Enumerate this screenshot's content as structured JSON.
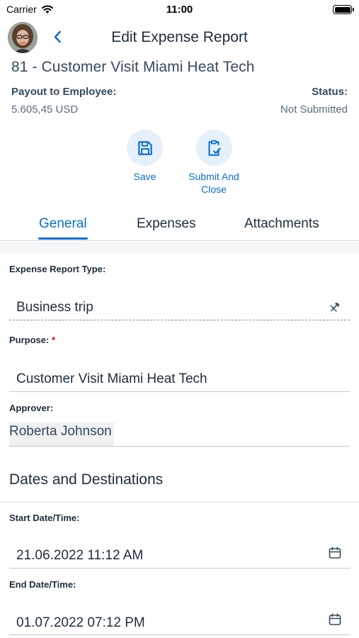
{
  "status_bar": {
    "carrier": "Carrier",
    "time": "11:00"
  },
  "header": {
    "title": "Edit Expense Report",
    "report_title": "81 - Customer Visit Miami Heat Tech"
  },
  "summary": {
    "payout_label": "Payout to Employee:",
    "payout_value": "5.605,45 USD",
    "status_label": "Status:",
    "status_value": "Not Submitted"
  },
  "actions": {
    "save_label": "Save",
    "submit_label_line1": "Submit And",
    "submit_label_line2": "Close"
  },
  "tabs": [
    {
      "label": "General",
      "selected": true
    },
    {
      "label": "Expenses",
      "selected": false
    },
    {
      "label": "Attachments",
      "selected": false
    }
  ],
  "form": {
    "expense_type_label": "Expense Report Type:",
    "expense_type_value": "Business trip",
    "purpose_label": "Purpose:",
    "purpose_required": "*",
    "purpose_value": "Customer Visit Miami Heat Tech",
    "approver_label": "Approver:",
    "approver_value": "Roberta Johnson",
    "section_title": "Dates and Destinations",
    "start_label": "Start Date/Time:",
    "start_value": "21.06.2022 11:12 AM",
    "end_label": "End Date/Time:",
    "end_value": "01.07.2022 07:12 PM"
  },
  "colors": {
    "accent": "#0a6ed1",
    "action_bg": "#e5f0fa",
    "text": "#1d2d3e",
    "required": "#ee0000"
  },
  "icons": [
    "wifi-icon",
    "battery-icon",
    "back-chevron-icon",
    "save-icon",
    "clipboard-check-icon",
    "clear-value-icon",
    "calendar-icon"
  ]
}
